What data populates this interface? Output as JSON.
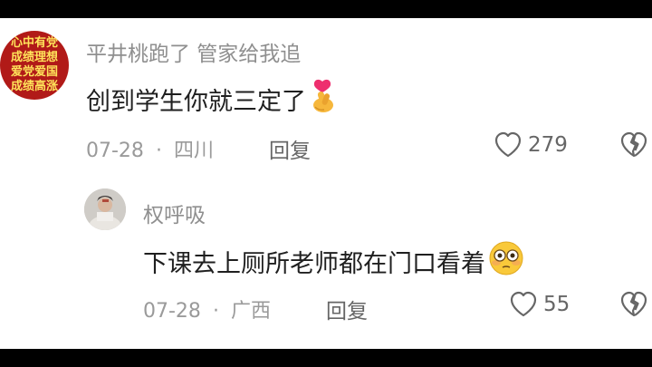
{
  "comments": [
    {
      "avatar_text": [
        "心中有党",
        "成绩理想",
        "爱党爱国",
        "成绩高涨"
      ],
      "username": "平井桃跑了 管家给我追",
      "text": "创到学生你就三定了",
      "date": "07-28",
      "separator": "·",
      "location": "四川",
      "reply_label": "回复",
      "likes": "279",
      "emoji": "finger-heart-emoji"
    },
    {
      "username": "权呼吸",
      "text": "下课去上厕所老师都在门口看着",
      "date": "07-28",
      "separator": "·",
      "location": "广西",
      "reply_label": "回复",
      "likes": "55",
      "emoji": "flushed-face-emoji"
    }
  ],
  "colors": {
    "avatar_bg": "#b11a18",
    "avatar_text": "#ffe35a",
    "username": "#8f8f8f",
    "meta": "#9a9a9a"
  }
}
